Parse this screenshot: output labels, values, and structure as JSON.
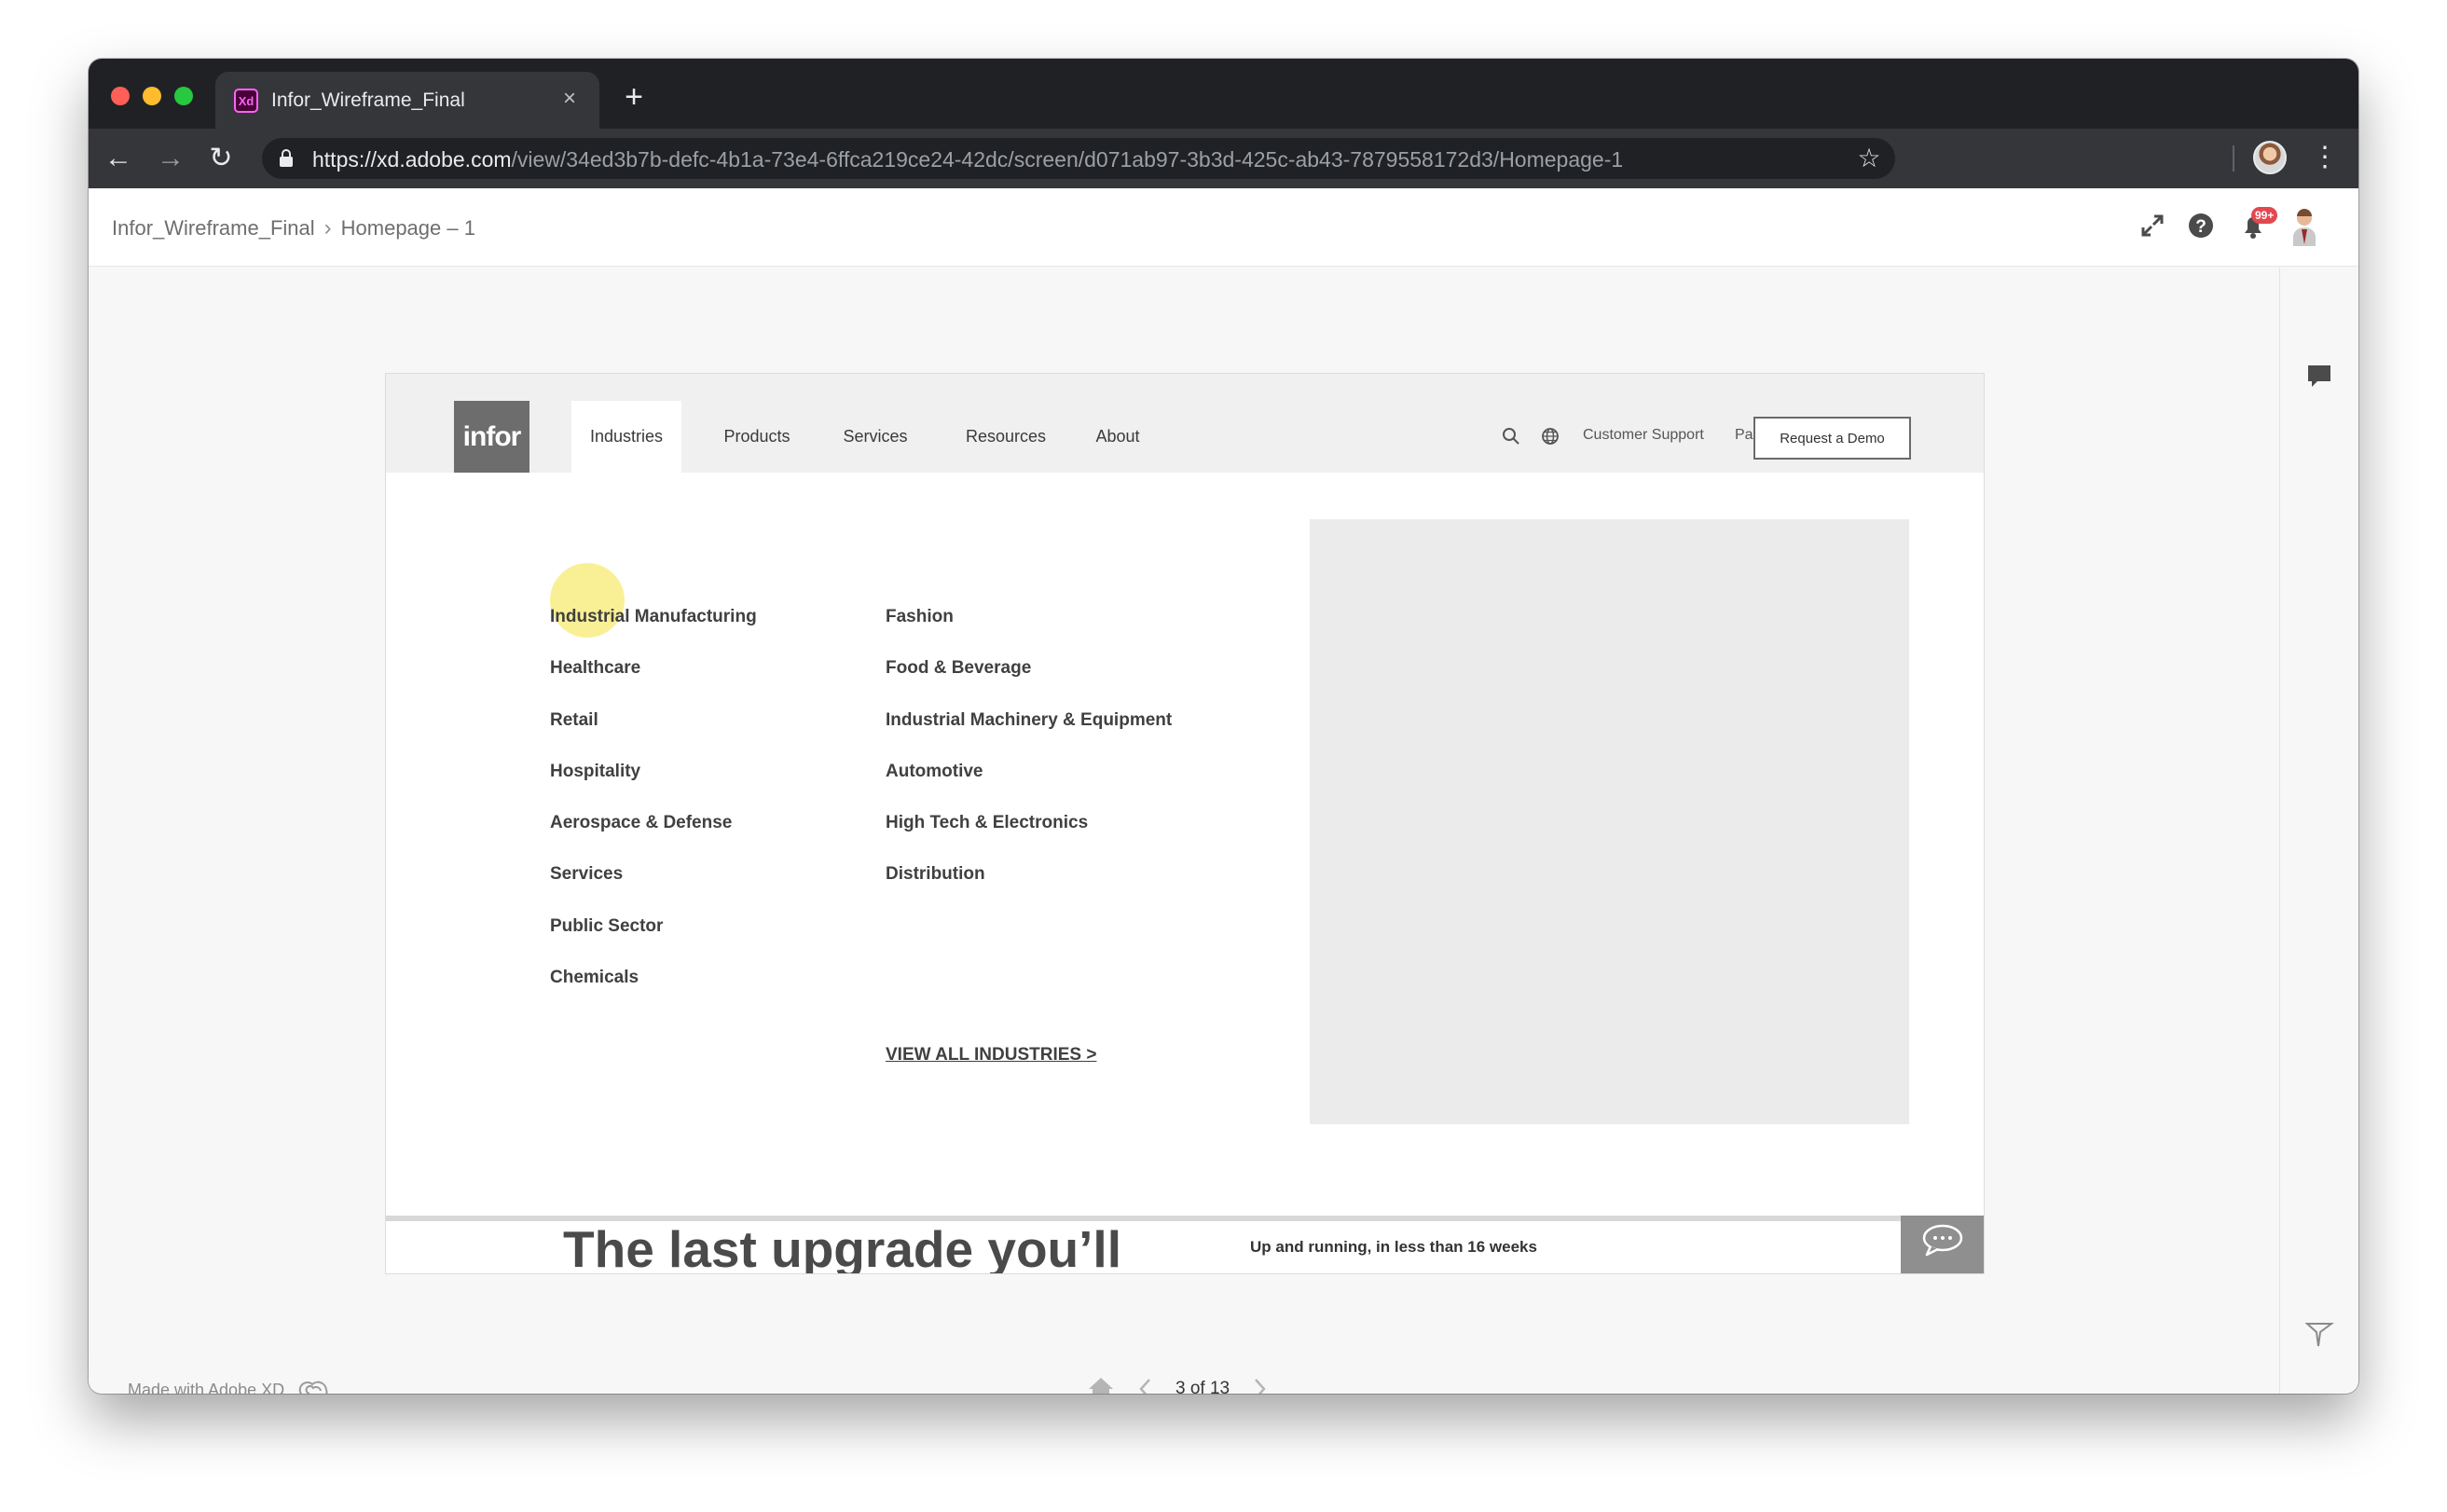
{
  "browser": {
    "tab_title": "Infor_Wireframe_Final",
    "favicon_text": "Xd",
    "url_host": "https://xd.adobe.com",
    "url_path": "/view/34ed3b7b-defc-4b1a-73e4-6ffca219ce24-42dc/screen/d071ab97-3b3d-425c-ab43-7879558172d3/Homepage-1"
  },
  "xd_header": {
    "breadcrumb": [
      "Infor_Wireframe_Final",
      "Homepage – 1"
    ],
    "notification_badge": "99+"
  },
  "site": {
    "logo": "infor",
    "nav": [
      "Industries",
      "Products",
      "Services",
      "Resources",
      "About"
    ],
    "utility_links": [
      "Customer Support",
      "Partners"
    ],
    "demo_button": "Request a Demo",
    "industries_col1": [
      "Industrial Manufacturing",
      "Healthcare",
      "Retail",
      "Hospitality",
      "Aerospace & Defense",
      "Services",
      "Public Sector",
      "Chemicals"
    ],
    "industries_col2": [
      "Fashion",
      "Food & Beverage",
      "Industrial Machinery & Equipment",
      "Automotive",
      "High Tech & Electronics",
      "Distribution"
    ],
    "view_all": "VIEW ALL INDUSTRIES >",
    "hero_title": "The last upgrade you’ll",
    "hero_subtitle": "Up and running, in less than 16 weeks"
  },
  "viewer_footer": {
    "made_with": "Made with Adobe XD",
    "page_counter": "3 of 13"
  },
  "colors": {
    "chrome_dark": "#202124",
    "chrome_toolbar": "#35363a",
    "highlight": "#f7ea6e",
    "logo_bg": "#6d6d6d"
  }
}
